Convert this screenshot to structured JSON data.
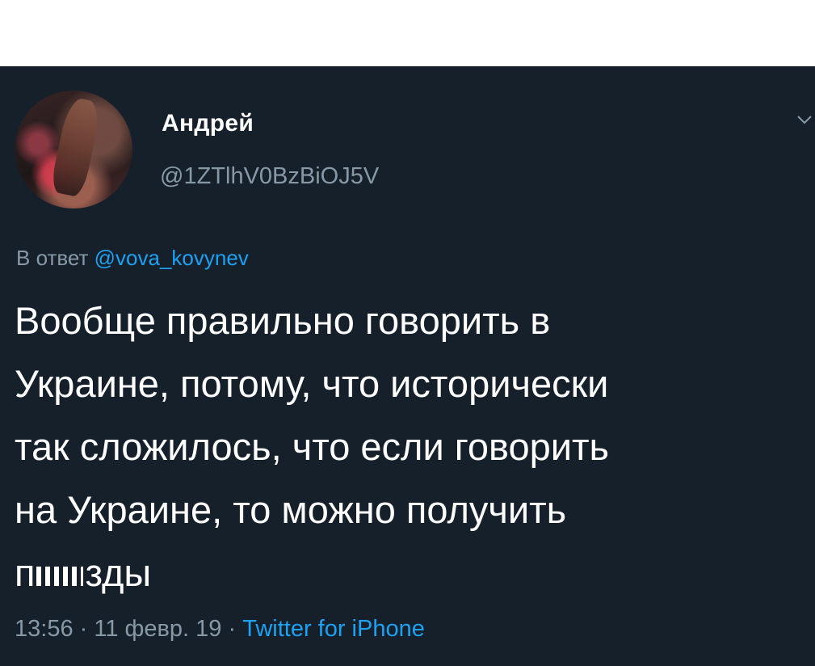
{
  "tweet": {
    "display_name": "Андрей",
    "username": "@1ZTlhV0BzBiOJ5V",
    "reply_prefix": "В ответ ",
    "reply_mention": "@vova_kovynev",
    "text_lines": [
      "Вообще правильно говорить в",
      "Украине, потому, что исторически",
      "так сложилось, что если говорить",
      "на Украине, то можно получить"
    ],
    "last_line_start": "п",
    "last_line_end": "зды",
    "time": "13:56",
    "separator": " · ",
    "date": "11 февр. 19",
    "source": "Twitter for iPhone"
  },
  "icons": {
    "menu": "chevron-down-icon",
    "avatar": "profile-photo"
  },
  "colors": {
    "background": "#15202b",
    "text": "#ffffff",
    "secondary_text": "#8899a6",
    "link": "#1da1f2"
  }
}
